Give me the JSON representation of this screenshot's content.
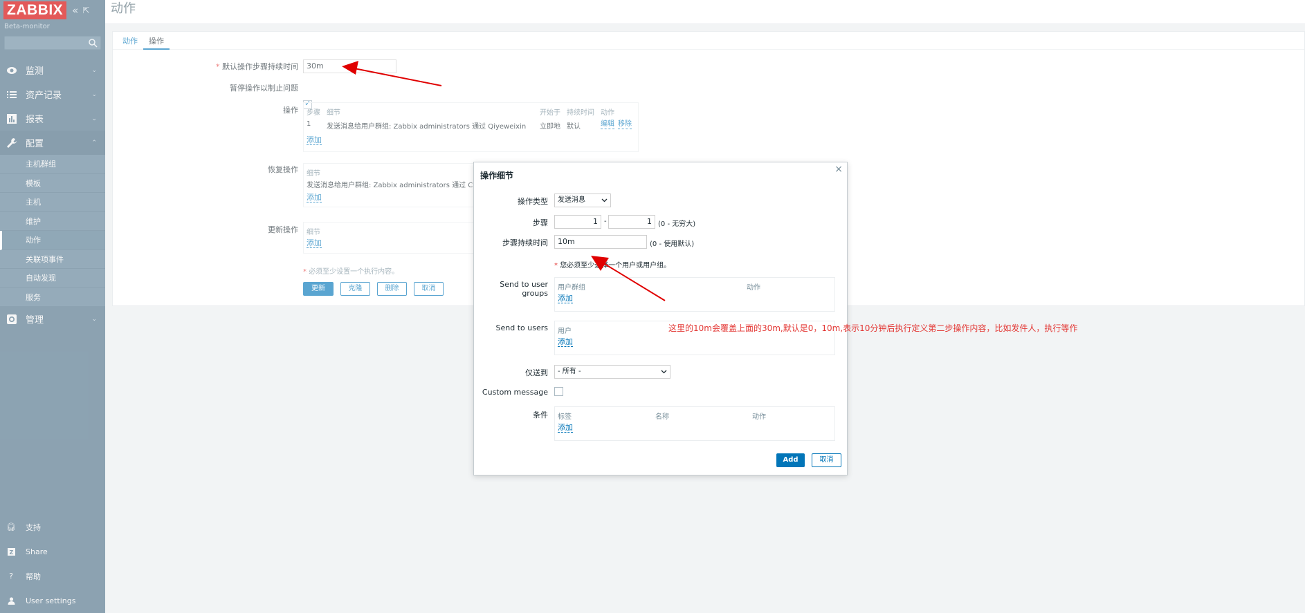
{
  "sidebar": {
    "logo": "ZABBIX",
    "server_name": "Beta-monitor",
    "search_placeholder": "",
    "menu": [
      {
        "label": "监测",
        "icon": "eye-icon"
      },
      {
        "label": "资产记录",
        "icon": "list-icon"
      },
      {
        "label": "报表",
        "icon": "chart-icon"
      },
      {
        "label": "配置",
        "icon": "wrench-icon"
      }
    ],
    "submenu": [
      "主机群组",
      "模板",
      "主机",
      "维护",
      "动作",
      "关联项事件",
      "自动发现",
      "服务"
    ],
    "admin": {
      "label": "管理",
      "icon": "gear-icon"
    },
    "bottom": [
      {
        "label": "支持",
        "icon": "headset-icon"
      },
      {
        "label": "Share",
        "icon": "share-icon"
      },
      {
        "label": "帮助",
        "icon": "help-icon"
      },
      {
        "label": "User settings",
        "icon": "user-icon"
      }
    ]
  },
  "header": {
    "title": "动作"
  },
  "tabs": [
    "动作",
    "操作"
  ],
  "form": {
    "default_step_label": "默认操作步骤持续时间",
    "default_step_value": "30m",
    "pause_label": "暂停操作以制止问题",
    "operations_label": "操作",
    "ops_headers": [
      "步骤",
      "细节",
      "开始于",
      "持续时间",
      "动作"
    ],
    "ops_row": {
      "step": "1",
      "detail": "发送消息给用户群组: Zabbix administrators 通过 Qiyeweixin",
      "start": "立即地",
      "duration": "默认",
      "edit": "编辑",
      "remove": "移除"
    },
    "add": "添加",
    "recovery_label": "恢复操作",
    "recovery_header": "细节",
    "recovery_detail": "发送消息给用户群组: Zabbix administrators 通过 C",
    "update_label": "更新操作",
    "update_header": "细节",
    "required_note": "必须至少设置一个执行内容。",
    "buttons": {
      "update": "更新",
      "clone": "克隆",
      "delete": "删除",
      "cancel": "取消"
    }
  },
  "dialog": {
    "title": "操作细节",
    "close": "×",
    "op_type_label": "操作类型",
    "op_type_value": "发送消息",
    "steps_label": "步骤",
    "step_from": "1",
    "step_to": "1",
    "steps_hint": "(0 - 无穷大)",
    "step_duration_label": "步骤持续时间",
    "step_duration_value": "10m",
    "step_duration_hint": "(0 - 使用默认)",
    "must_note": "您必须至少选择一个用户或用户组。",
    "groups_label": "Send to user groups",
    "groups_headers": [
      "用户群组",
      "动作"
    ],
    "users_label": "Send to users",
    "users_header": "用户",
    "add": "添加",
    "only_to_label": "仅送到",
    "only_to_value": "- 所有 -",
    "custom_msg_label": "Custom message",
    "conditions_label": "条件",
    "cond_headers": [
      "标签",
      "名称",
      "动作"
    ],
    "add_button": "Add",
    "cancel_button": "取消"
  },
  "annotation": "这里的10m会覆盖上面的30m,默认是0，10m,表示10分钟后执行定义第二步操作内容，比如发件人，执行等作",
  "colors": {
    "sidebar": "#4f7188",
    "link": "#0275b8",
    "logo": "#d40000",
    "arrow": "#e00000"
  }
}
